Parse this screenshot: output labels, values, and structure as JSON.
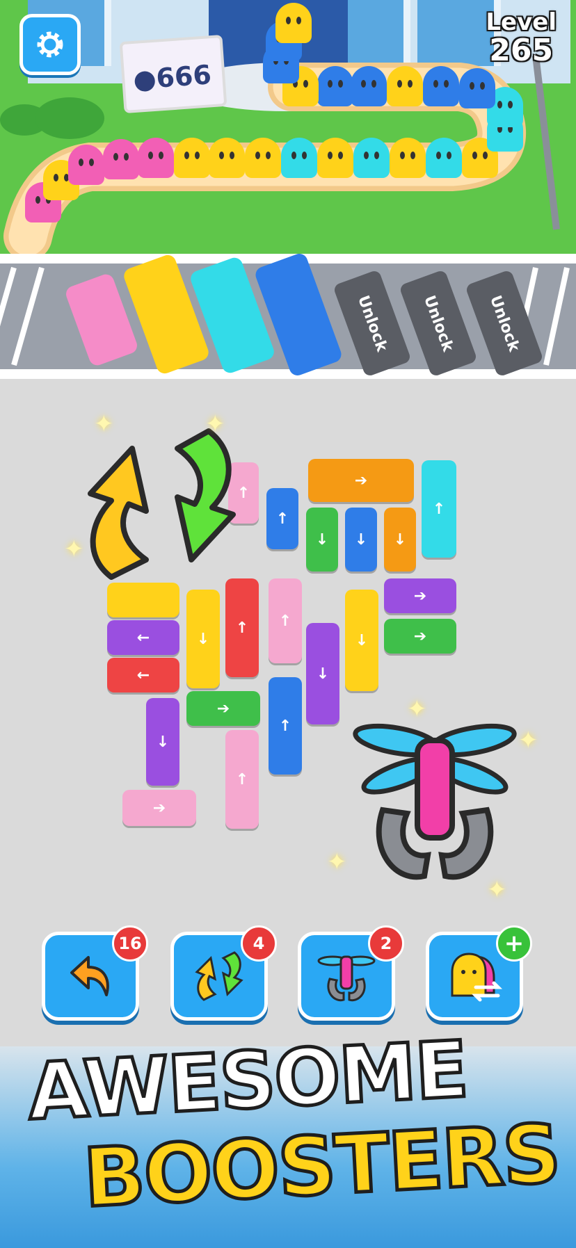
{
  "hud": {
    "level_label": "Level",
    "level_number": "265",
    "crowd_count": "666"
  },
  "queue_colors": [
    "#f25fb5",
    "#ffd21a",
    "#33dbe8",
    "#2f7de8"
  ],
  "parking": {
    "unlock_labels": [
      "Unlock",
      "Unlock",
      "Unlock"
    ]
  },
  "boosters": [
    {
      "name": "undo",
      "count": "16"
    },
    {
      "name": "shuffle",
      "count": "4"
    },
    {
      "name": "helicopter",
      "count": "2"
    },
    {
      "name": "swap-passengers",
      "count": "+"
    }
  ],
  "banner": {
    "line1": "AWESOME",
    "line2": "BOOSTERS"
  },
  "colors": {
    "blue_button": "#2aa8f4",
    "badge_red": "#e83a3a",
    "badge_green": "#38c23a",
    "title_yellow": "#ffd21a"
  }
}
